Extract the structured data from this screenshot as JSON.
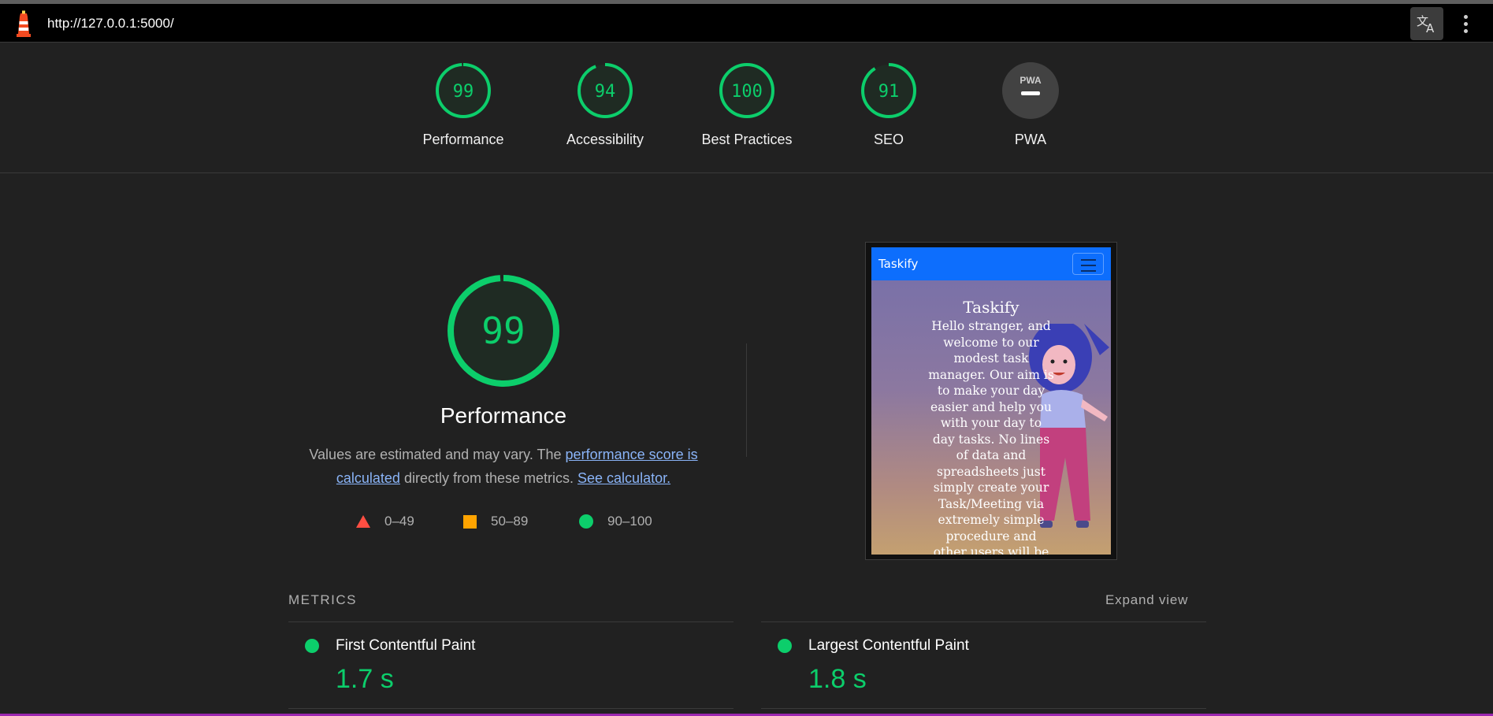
{
  "browser": {
    "url": "http://127.0.0.1:5000/",
    "icons": {
      "logo": "lighthouse-icon",
      "translate": "translate-icon",
      "menu": "more-vert-icon"
    }
  },
  "gauges": [
    {
      "value": "99",
      "label": "Performance",
      "fraction": 0.99
    },
    {
      "value": "94",
      "label": "Accessibility",
      "fraction": 0.94
    },
    {
      "value": "100",
      "label": "Best Practices",
      "fraction": 1.0
    },
    {
      "value": "91",
      "label": "SEO",
      "fraction": 0.91
    },
    {
      "value": "",
      "label": "PWA",
      "badge": "PWA"
    }
  ],
  "performance": {
    "score": "99",
    "fraction": 0.99,
    "title": "Performance",
    "desc_prefix": "Values are estimated and may vary. The ",
    "link1": "performance score is calculated",
    "desc_middle": " directly from these metrics. ",
    "link2": "See calculator.",
    "legend": {
      "fail": "0–49",
      "average": "50–89",
      "pass": "90–100"
    }
  },
  "screenshot": {
    "brand": "Taskify",
    "title": "Taskify",
    "text": "Hello stranger, and welcome to our modest task manager. Our aim is to make your day easier and help you with your day to day tasks. No lines of data and spreadsheets just simply create your Task/Meeting via extremely simple procedure and other users will be"
  },
  "metrics": {
    "heading": "METRICS",
    "expand": "Expand view",
    "items": [
      {
        "name": "First Contentful Paint",
        "value": "1.7 s"
      },
      {
        "name": "Largest Contentful Paint",
        "value": "1.8 s"
      }
    ]
  },
  "colors": {
    "pass": "#0cce6b",
    "average": "#ffa400",
    "fail": "#ff4e42",
    "background": "#212121",
    "link": "#8ab4f8"
  }
}
